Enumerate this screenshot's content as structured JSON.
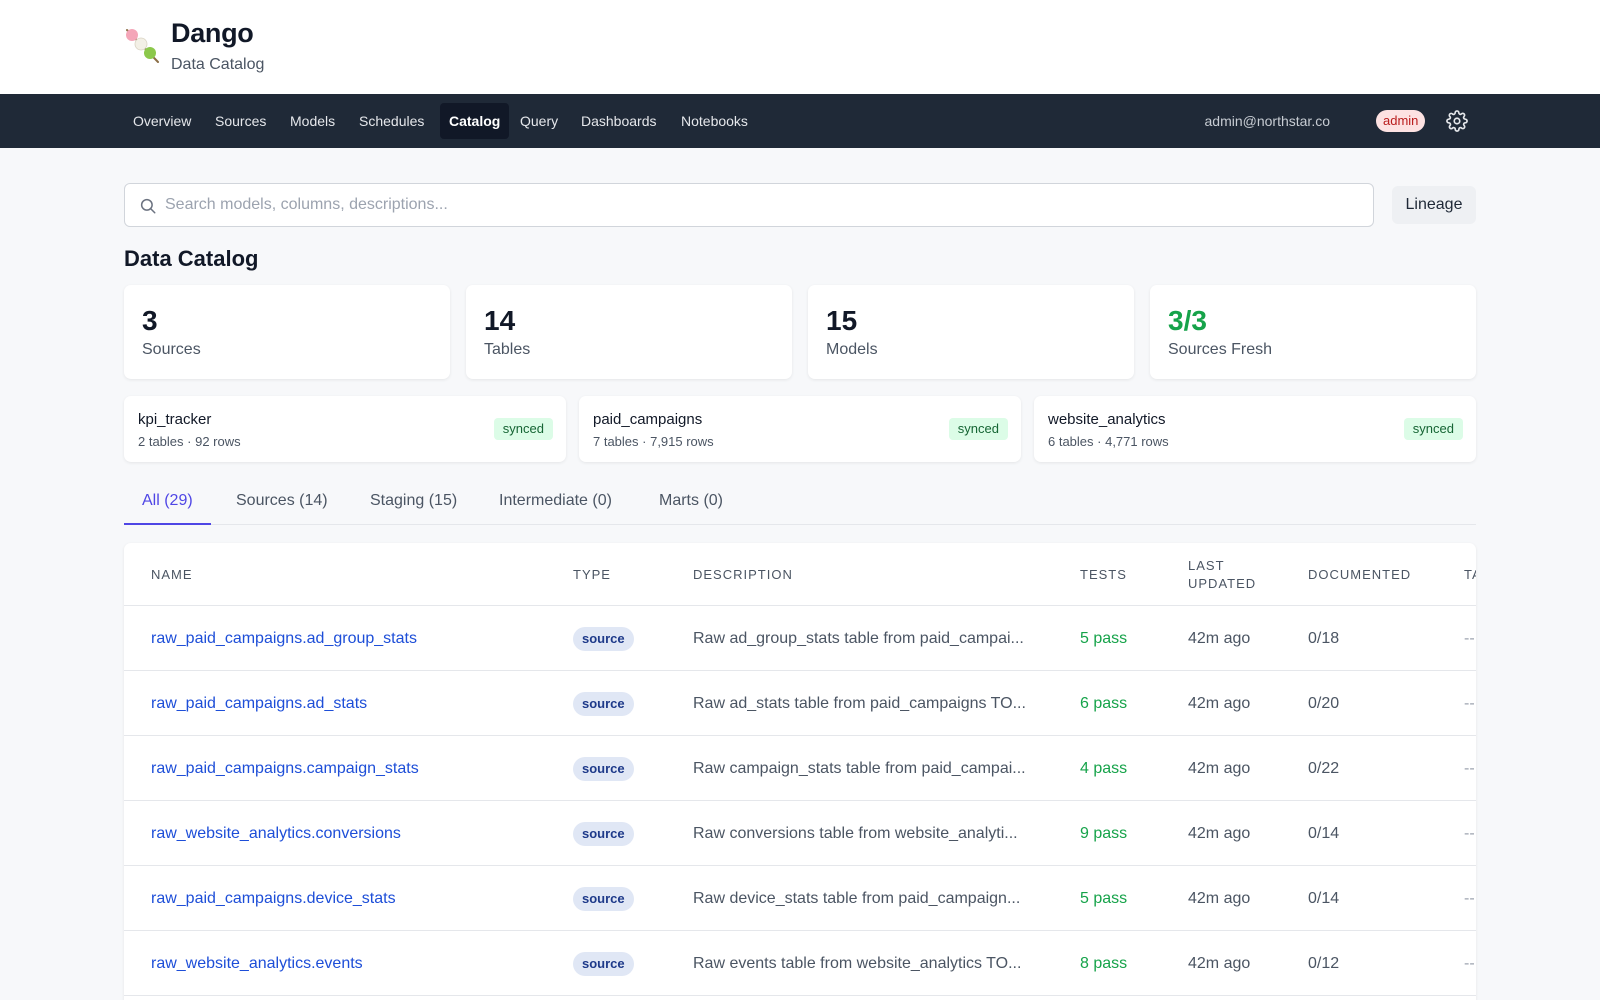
{
  "app": {
    "title": "Dango",
    "subtitle": "Data Catalog"
  },
  "nav": {
    "items": [
      "Overview",
      "Sources",
      "Models",
      "Schedules",
      "Catalog",
      "Query",
      "Dashboards",
      "Notebooks"
    ],
    "active": "Catalog",
    "user_email": "admin@northstar.co",
    "role": "admin"
  },
  "search": {
    "placeholder": "Search models, columns, descriptions...",
    "value": ""
  },
  "lineage_label": "Lineage",
  "section_title": "Data Catalog",
  "stats": [
    {
      "value": "3",
      "label": "Sources"
    },
    {
      "value": "14",
      "label": "Tables"
    },
    {
      "value": "15",
      "label": "Models"
    },
    {
      "value": "3/3",
      "label": "Sources Fresh"
    }
  ],
  "sources": [
    {
      "name": "kpi_tracker",
      "meta": "2 tables · 92 rows",
      "status": "synced"
    },
    {
      "name": "paid_campaigns",
      "meta": "7 tables · 7,915 rows",
      "status": "synced"
    },
    {
      "name": "website_analytics",
      "meta": "6 tables · 4,771 rows",
      "status": "synced"
    }
  ],
  "tabs": [
    "All (29)",
    "Sources (14)",
    "Staging (15)",
    "Intermediate (0)",
    "Marts (0)"
  ],
  "table": {
    "headers": {
      "name": "NAME",
      "type": "TYPE",
      "description": "DESCRIPTION",
      "tests": "TESTS",
      "last_updated_1": "LAST",
      "last_updated_2": "UPDATED",
      "documented": "DOCUMENTED",
      "tags": "TA"
    },
    "rows": [
      {
        "name": "raw_paid_campaigns.ad_group_stats",
        "type": "source",
        "description": "Raw ad_group_stats table from paid_campai...",
        "tests": "5 pass",
        "updated": "42m ago",
        "documented": "0/18",
        "tags": "--"
      },
      {
        "name": "raw_paid_campaigns.ad_stats",
        "type": "source",
        "description": "Raw ad_stats table from paid_campaigns TO...",
        "tests": "6 pass",
        "updated": "42m ago",
        "documented": "0/20",
        "tags": "--"
      },
      {
        "name": "raw_paid_campaigns.campaign_stats",
        "type": "source",
        "description": "Raw campaign_stats table from paid_campai...",
        "tests": "4 pass",
        "updated": "42m ago",
        "documented": "0/22",
        "tags": "--"
      },
      {
        "name": "raw_website_analytics.conversions",
        "type": "source",
        "description": "Raw conversions table from website_analyti...",
        "tests": "9 pass",
        "updated": "42m ago",
        "documented": "0/14",
        "tags": "--"
      },
      {
        "name": "raw_paid_campaigns.device_stats",
        "type": "source",
        "description": "Raw device_stats table from paid_campaign...",
        "tests": "5 pass",
        "updated": "42m ago",
        "documented": "0/14",
        "tags": "--"
      },
      {
        "name": "raw_website_analytics.events",
        "type": "source",
        "description": "Raw events table from website_analytics TO...",
        "tests": "8 pass",
        "updated": "42m ago",
        "documented": "0/12",
        "tags": "--"
      }
    ]
  },
  "colors": {
    "nav_bg": "#1f2937",
    "accent": "#4f46e5",
    "link": "#1d4ed8",
    "success": "#16a34a"
  }
}
